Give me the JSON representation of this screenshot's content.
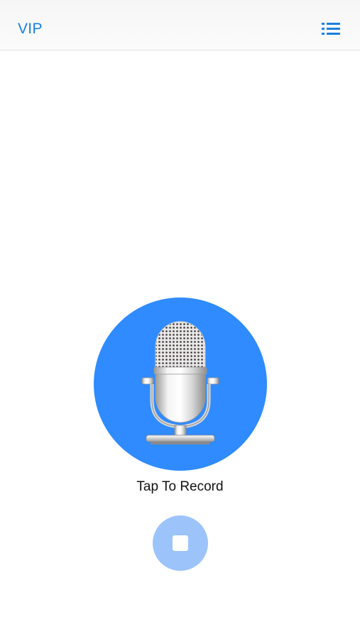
{
  "nav": {
    "vip_label": "VIP",
    "right_icon": "list-icon"
  },
  "recorder": {
    "mic_icon": "microphone-icon",
    "label": "Tap To Record",
    "stop_icon": "stop-icon"
  },
  "colors": {
    "accent": "#2f8bff",
    "link": "#1a7fe0",
    "stop_button_disabled": "#9cc4fb"
  }
}
